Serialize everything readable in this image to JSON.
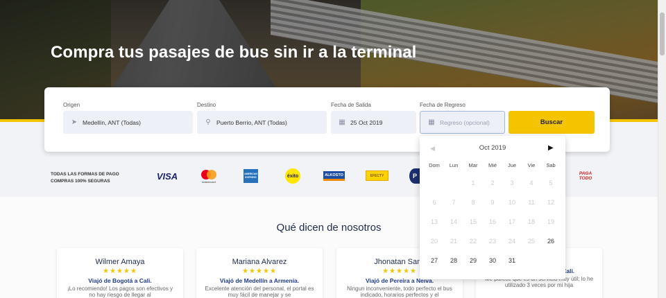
{
  "hero": {
    "title": "Compra tus pasajes de bus sin ir a la terminal"
  },
  "search": {
    "origin_label": "Origen",
    "origin_value": "Medellín, ANT (Todas)",
    "dest_label": "Destino",
    "dest_value": "Puerto Berrio, ANT (Todas)",
    "depart_label": "Fecha de Salida",
    "depart_value": "25 Oct 2019",
    "return_label": "Fecha de Regreso",
    "return_placeholder": "Regreso (opcional)",
    "button": "Buscar"
  },
  "payments": {
    "line1": "TODAS LAS FORMAS DE PAGO",
    "line2": "COMPRAS 100% SEGURAS",
    "logos": [
      "VISA",
      "mastercard",
      "AMERICAN EXPRESS",
      "éxito",
      "ALKOSTO",
      "EFECTY",
      "P",
      "PAGA TODO"
    ]
  },
  "testimonials": {
    "title": "Qué dicen de nosotros",
    "items": [
      {
        "name": "Wilmer Amaya",
        "trip": "Viajó de Bogotá a Cali.",
        "quote": "¡Lo recomiendo! Los pagos son efectivos y no hay riesgo de llegar al"
      },
      {
        "name": "Mariana Alvarez",
        "trip": "Viajó de Medellín a Armenia.",
        "quote": "Excelente atención del personal, el portal es muy fácil de manejar y se"
      },
      {
        "name": "Jhonatan Sanc",
        "trip": "Viajó de Pereira a Neiva.",
        "quote": "Ningun inconveniente, todo perfecto el bus indicado, horarios perfectos y el"
      },
      {
        "name": "",
        "trip": "Viajó de Manizales a Cali.",
        "quote": "Me parece que es un servicio muy útil; lo he utilizado 3 veces por mi hija"
      }
    ],
    "stars": "★★★★★"
  },
  "calendar": {
    "prev": "◀",
    "next": "▶",
    "month": "Oct 2019",
    "dow": [
      "Dom",
      "Lun",
      "Mar",
      "Mié",
      "Jue",
      "Vie",
      "Sab"
    ],
    "days": [
      "",
      "",
      "1",
      "2",
      "3",
      "4",
      "5",
      "6",
      "7",
      "8",
      "9",
      "10",
      "11",
      "12",
      "13",
      "14",
      "15",
      "16",
      "17",
      "18",
      "19",
      "20",
      "21",
      "22",
      "23",
      "24",
      "25",
      "26",
      "27",
      "28",
      "29",
      "30",
      "31",
      "",
      ""
    ],
    "first_enabled_day": 26
  }
}
